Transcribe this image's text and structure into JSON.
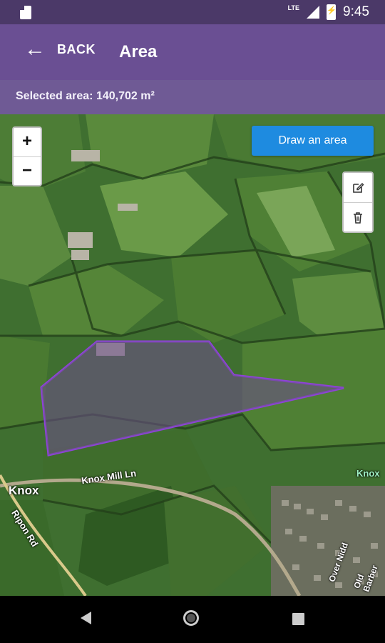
{
  "status_bar": {
    "time": "9:45",
    "network": "LTE",
    "icons": [
      "sd-card-icon",
      "signal-icon",
      "battery-charging-icon"
    ]
  },
  "app_bar": {
    "back_label": "BACK",
    "title": "Area"
  },
  "info": {
    "selected_area": "Selected area: 140,702 m²"
  },
  "map": {
    "zoom_in": "+",
    "zoom_out": "−",
    "draw_button": "Draw an area",
    "tools": [
      "edit-icon",
      "trash-icon"
    ],
    "labels": {
      "place": "Knox",
      "road1": "Knox Mill Ln",
      "road2": "Ripon Rd",
      "road3": "Over Nidd",
      "road4": "Old Barber",
      "place2": "Knox"
    },
    "polygon_color": "#8e44d9"
  },
  "colors": {
    "status_bar": "#4b3968",
    "app_bar": "#6a4f93",
    "info_bar": "#6f5a95",
    "button": "#1e8be0"
  },
  "nav_bar": [
    "back-nav-icon",
    "home-nav-icon",
    "recent-apps-icon"
  ]
}
